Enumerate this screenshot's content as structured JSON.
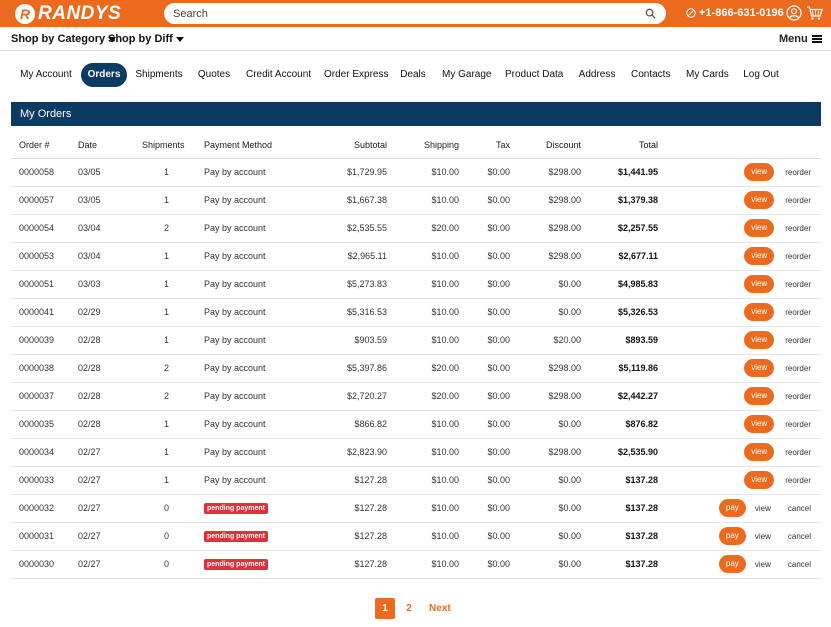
{
  "header": {
    "logo_letter": "R",
    "logo_text": "RANDYS",
    "search_placeholder": "Search",
    "phone": "+1-866-631-0196",
    "brand_color": "#ec6a1e"
  },
  "subnav": {
    "shop_category": "Shop by Category",
    "shop_diff": "Shop by Diff",
    "menu": "Menu"
  },
  "tabs": [
    {
      "label": "My Account"
    },
    {
      "label": "Orders"
    },
    {
      "label": "Shipments"
    },
    {
      "label": "Quotes"
    },
    {
      "label": "Credit Account"
    },
    {
      "label": "Order Express"
    },
    {
      "label": "Deals"
    },
    {
      "label": "My Garage"
    },
    {
      "label": "Product Data"
    },
    {
      "label": "Address"
    },
    {
      "label": "Contacts"
    },
    {
      "label": "My Cards"
    },
    {
      "label": "Log Out"
    }
  ],
  "active_tab": "Orders",
  "panel": {
    "title": "My Orders",
    "header_color": "#0b3a63"
  },
  "columns": [
    "Order #",
    "Date",
    "Shipments",
    "Payment Method",
    "Subtotal",
    "Shipping",
    "Tax",
    "Discount",
    "Total"
  ],
  "actions": {
    "view": "view",
    "reorder": "reorder",
    "pay": "pay",
    "cancel": "cancel"
  },
  "orders": [
    {
      "num": "0000058",
      "date": "03/05",
      "shipments": "1",
      "payment": "Pay by account",
      "pending": false,
      "subtotal": "$1,729.95",
      "shipping": "$10.00",
      "tax": "$0.00",
      "discount": "$298.00",
      "total": "$1,441.95"
    },
    {
      "num": "0000057",
      "date": "03/05",
      "shipments": "1",
      "payment": "Pay by account",
      "pending": false,
      "subtotal": "$1,667.38",
      "shipping": "$10.00",
      "tax": "$0.00",
      "discount": "$298.00",
      "total": "$1,379.38"
    },
    {
      "num": "0000054",
      "date": "03/04",
      "shipments": "2",
      "payment": "Pay by account",
      "pending": false,
      "subtotal": "$2,535.55",
      "shipping": "$20.00",
      "tax": "$0.00",
      "discount": "$298.00",
      "total": "$2,257.55"
    },
    {
      "num": "0000053",
      "date": "03/04",
      "shipments": "1",
      "payment": "Pay by account",
      "pending": false,
      "subtotal": "$2,965.11",
      "shipping": "$10.00",
      "tax": "$0.00",
      "discount": "$298.00",
      "total": "$2,677.11"
    },
    {
      "num": "0000051",
      "date": "03/03",
      "shipments": "1",
      "payment": "Pay by account",
      "pending": false,
      "subtotal": "$5,273.83",
      "shipping": "$10.00",
      "tax": "$0.00",
      "discount": "$0.00",
      "total": "$4,985.83"
    },
    {
      "num": "0000041",
      "date": "02/29",
      "shipments": "1",
      "payment": "Pay by account",
      "pending": false,
      "subtotal": "$5,316.53",
      "shipping": "$10.00",
      "tax": "$0.00",
      "discount": "$0.00",
      "total": "$5,326.53"
    },
    {
      "num": "0000039",
      "date": "02/28",
      "shipments": "1",
      "payment": "Pay by account",
      "pending": false,
      "subtotal": "$903.59",
      "shipping": "$10.00",
      "tax": "$0.00",
      "discount": "$20.00",
      "total": "$893.59"
    },
    {
      "num": "0000038",
      "date": "02/28",
      "shipments": "2",
      "payment": "Pay by account",
      "pending": false,
      "subtotal": "$5,397.86",
      "shipping": "$20.00",
      "tax": "$0.00",
      "discount": "$298.00",
      "total": "$5,119.86"
    },
    {
      "num": "0000037",
      "date": "02/28",
      "shipments": "2",
      "payment": "Pay by account",
      "pending": false,
      "subtotal": "$2,720.27",
      "shipping": "$20.00",
      "tax": "$0.00",
      "discount": "$298.00",
      "total": "$2,442.27"
    },
    {
      "num": "0000035",
      "date": "02/28",
      "shipments": "1",
      "payment": "Pay by account",
      "pending": false,
      "subtotal": "$866.82",
      "shipping": "$10.00",
      "tax": "$0.00",
      "discount": "$0.00",
      "total": "$876.82"
    },
    {
      "num": "0000034",
      "date": "02/27",
      "shipments": "1",
      "payment": "Pay by account",
      "pending": false,
      "subtotal": "$2,823.90",
      "shipping": "$10.00",
      "tax": "$0.00",
      "discount": "$298.00",
      "total": "$2,535.90"
    },
    {
      "num": "0000033",
      "date": "02/27",
      "shipments": "1",
      "payment": "Pay by account",
      "pending": false,
      "subtotal": "$127.28",
      "shipping": "$10.00",
      "tax": "$0.00",
      "discount": "$0.00",
      "total": "$137.28"
    },
    {
      "num": "0000032",
      "date": "02/27",
      "shipments": "0",
      "payment": "pending payment",
      "pending": true,
      "subtotal": "$127.28",
      "shipping": "$10.00",
      "tax": "$0.00",
      "discount": "$0.00",
      "total": "$137.28"
    },
    {
      "num": "0000031",
      "date": "02/27",
      "shipments": "0",
      "payment": "pending payment",
      "pending": true,
      "subtotal": "$127.28",
      "shipping": "$10.00",
      "tax": "$0.00",
      "discount": "$0.00",
      "total": "$137.28"
    },
    {
      "num": "0000030",
      "date": "02/27",
      "shipments": "0",
      "payment": "pending payment",
      "pending": true,
      "subtotal": "$127.28",
      "shipping": "$10.00",
      "tax": "$0.00",
      "discount": "$0.00",
      "total": "$137.28"
    }
  ],
  "pagination": {
    "pages": [
      "1",
      "2"
    ],
    "current": "1",
    "next": "Next"
  }
}
